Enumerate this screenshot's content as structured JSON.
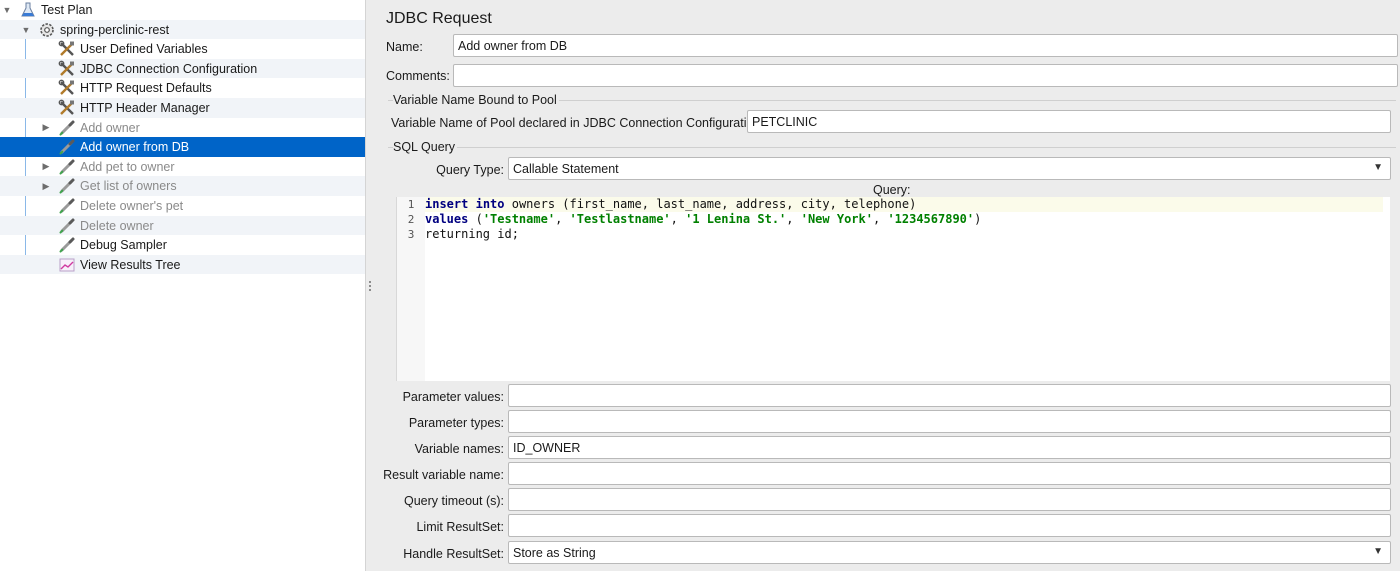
{
  "tree": {
    "items": [
      {
        "label": "Test Plan",
        "icon": "test-plan-flask-icon",
        "state": "normal"
      },
      {
        "label": "spring-perclinic-rest",
        "icon": "thread-group-gear-icon",
        "state": "normal"
      },
      {
        "label": "User Defined Variables",
        "icon": "config-tools-icon",
        "state": "normal"
      },
      {
        "label": "JDBC Connection Configuration",
        "icon": "config-tools-icon",
        "state": "normal"
      },
      {
        "label": "HTTP Request Defaults",
        "icon": "config-tools-icon",
        "state": "normal"
      },
      {
        "label": "HTTP Header Manager",
        "icon": "config-tools-icon",
        "state": "normal"
      },
      {
        "label": "Add owner",
        "icon": "sampler-pipette-icon",
        "state": "disabled"
      },
      {
        "label": "Add owner from DB",
        "icon": "sampler-pipette-icon",
        "state": "selected"
      },
      {
        "label": "Add pet to owner",
        "icon": "sampler-pipette-icon",
        "state": "disabled"
      },
      {
        "label": "Get list of owners",
        "icon": "sampler-pipette-icon",
        "state": "disabled"
      },
      {
        "label": "Delete owner's pet",
        "icon": "sampler-pipette-icon",
        "state": "disabled"
      },
      {
        "label": "Delete owner",
        "icon": "sampler-pipette-icon",
        "state": "disabled"
      },
      {
        "label": "Debug Sampler",
        "icon": "sampler-pipette-icon",
        "state": "normal"
      },
      {
        "label": "View Results Tree",
        "icon": "listener-graph-icon",
        "state": "normal"
      }
    ]
  },
  "panel": {
    "title": "JDBC Request",
    "name_label": "Name:",
    "name_value": "Add owner from DB",
    "comments_label": "Comments:",
    "comments_value": "",
    "pool_section_title": "Variable Name Bound to Pool",
    "pool_label": "Variable Name of Pool declared in JDBC Connection Configuration:",
    "pool_value": "PETCLINIC",
    "sql_section_title": "SQL Query",
    "query_type_label": "Query Type:",
    "query_type_value": "Callable Statement",
    "query_label": "Query:",
    "query_lines": [
      "insert into owners (first_name, last_name, address, city, telephone)",
      "values ('Testname', 'Testlastname', '1 Lenina St.', 'New York', '1234567890')",
      "returning id;"
    ],
    "line_numbers": [
      "1",
      "2",
      "3"
    ],
    "fields": [
      {
        "label": "Parameter values:",
        "value": ""
      },
      {
        "label": "Parameter types:",
        "value": ""
      },
      {
        "label": "Variable names:",
        "value": "ID_OWNER"
      },
      {
        "label": "Result variable name:",
        "value": ""
      },
      {
        "label": "Query timeout (s):",
        "value": ""
      },
      {
        "label": "Limit ResultSet:",
        "value": ""
      }
    ],
    "handle_label": "Handle ResultSet:",
    "handle_value": "Store as String"
  },
  "colors": {
    "selection": "#0064c8",
    "keyword": "#000080",
    "string": "#008000"
  }
}
